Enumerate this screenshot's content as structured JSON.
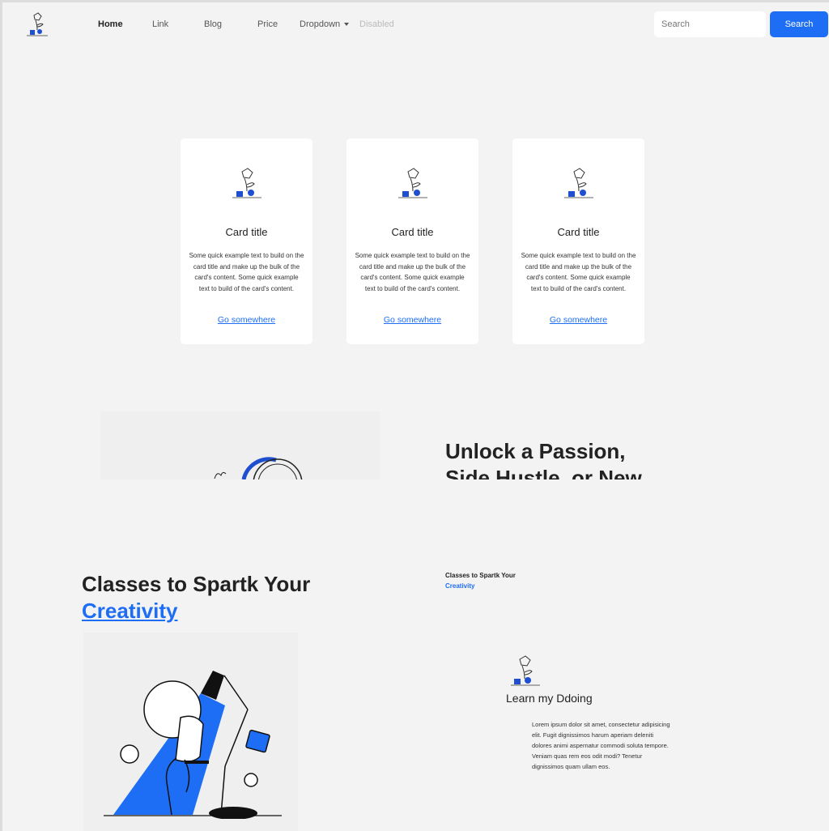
{
  "nav": {
    "links": [
      {
        "label": "Home",
        "state": "active"
      },
      {
        "label": "Link",
        "state": "default"
      },
      {
        "label": "Blog",
        "state": "default"
      },
      {
        "label": "Price",
        "state": "default"
      },
      {
        "label": "Dropdown",
        "state": "default"
      },
      {
        "label": "Disabled",
        "state": "disabled"
      }
    ],
    "search_placeholder": "Search",
    "search_button": "Search",
    "accent_color": "#1d6ef5"
  },
  "cards": [
    {
      "title": "Card title",
      "text": "Some quick example text to build on the card title and make up the bulk of the card's content. Some quick example text to build of the card's content.",
      "link": "Go somewhere",
      "icon": "flower-vase-icon"
    },
    {
      "title": "Card title",
      "text": "Some quick example text to build on the card title and make up the bulk of the card's content. Some quick example text to build of the card's content.",
      "link": "Go somewhere",
      "icon": "flower-vase-icon"
    },
    {
      "title": "Card title",
      "text": "Some quick example text to build on the card title and make up the bulk of the card's content. Some quick example text to build of the card's content.",
      "link": "Go somewhere",
      "icon": "flower-vase-icon"
    }
  ],
  "hero": {
    "line1": "Unlock a Passion,",
    "line2": "Side Hustle, or New"
  },
  "classes": {
    "heading_prefix": "Classes to Spartk Your",
    "heading_highlight": "Creativity",
    "mini_prefix": "Classes to Spartk Your",
    "mini_highlight": "Creativity"
  },
  "learn": {
    "title": "Learn my Ddoing",
    "text": "Lorem ipsum dolor sit amet, consectetur adipisicing elit. Fugit dignissimos harum aperiam deleniti dolores animi aspernatur commodi soluta tempore. Veniam quas rem eos odit modi? Tenetur dignissimos quam ullam eos.",
    "icon": "flower-vase-icon"
  }
}
